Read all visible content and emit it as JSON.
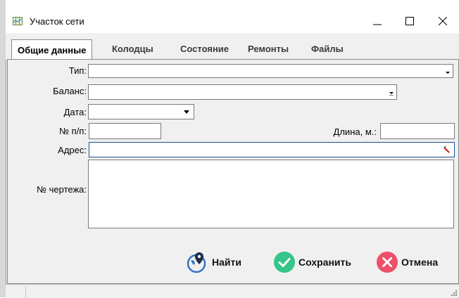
{
  "window": {
    "title": "Участок сети"
  },
  "tabs": [
    {
      "label": "Общие данные",
      "active": true
    },
    {
      "label": "Колодцы"
    },
    {
      "label": "Состояние"
    },
    {
      "label": "Ремонты"
    },
    {
      "label": "Файлы"
    }
  ],
  "form": {
    "type_label": "Тип:",
    "type_value": "",
    "balance_label": "Баланс:",
    "balance_value": "",
    "date_label": "Дата:",
    "date_value": "",
    "number_label": "№ п/п:",
    "number_value": "",
    "length_label": "Длина, м.:",
    "length_value": "",
    "address_label": "Адрес:",
    "address_value": "",
    "drawing_label": "№ чертежа:",
    "drawing_value": ""
  },
  "buttons": {
    "find": "Найти",
    "save": "Сохранить",
    "cancel": "Отмена"
  },
  "colors": {
    "accent_focus": "#1e4e9c",
    "find_icon": "#2f73c4",
    "save_icon": "#35c48a",
    "cancel_icon": "#ef4f68"
  }
}
